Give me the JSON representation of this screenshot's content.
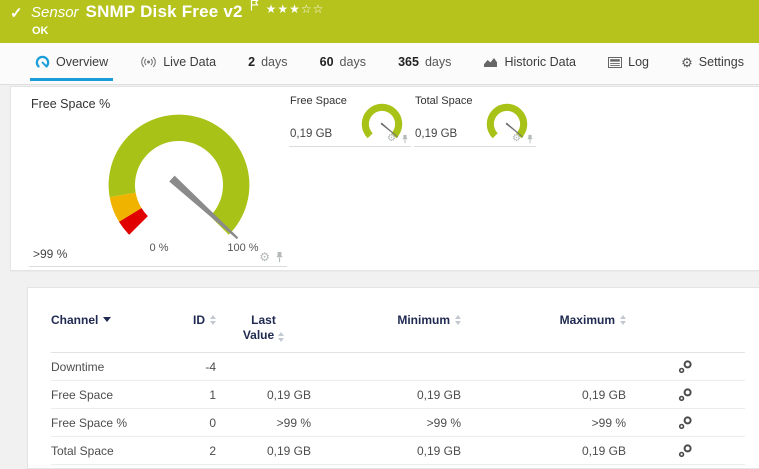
{
  "header": {
    "kind": "Sensor",
    "name": "SNMP Disk Free v2",
    "status": "OK",
    "stars_filled": "★★★",
    "stars_empty": "☆☆",
    "color": "#b5c31c"
  },
  "tabs": [
    {
      "icon": "gauge-icon",
      "label": "Overview",
      "active": true
    },
    {
      "icon": "live-icon",
      "label": "Live Data"
    },
    {
      "num": "2",
      "unit": "days"
    },
    {
      "num": "60",
      "unit": "days"
    },
    {
      "num": "365",
      "unit": "days"
    },
    {
      "icon": "historic-icon",
      "label": "Historic Data"
    },
    {
      "icon": "log-icon",
      "label": "Log"
    },
    {
      "icon": "settings-icon",
      "label": "Settings"
    }
  ],
  "gauges": {
    "main": {
      "title": "Free Space %",
      "value": ">99 %",
      "min_label": "0 %",
      "max_label": "100 %",
      "percent": 99,
      "unit": "%",
      "segments": [
        {
          "to": 5,
          "color": "#e00000"
        },
        {
          "to": 13,
          "color": "#f0b400"
        },
        {
          "to": 100,
          "color": "#a9c217"
        }
      ]
    },
    "minis": [
      {
        "title": "Free Space",
        "value": "0,19 GB",
        "percent": 98,
        "color": "#a9c217"
      },
      {
        "title": "Total Space",
        "value": "0,19 GB",
        "percent": 98,
        "color": "#a9c217"
      }
    ]
  },
  "table": {
    "columns": {
      "channel": "Channel",
      "id": "ID",
      "last_line1": "Last",
      "last_line2": "Value",
      "min": "Minimum",
      "max": "Maximum"
    },
    "rows": [
      {
        "channel": "Downtime",
        "id": "-4",
        "last": "",
        "min": "",
        "max": ""
      },
      {
        "channel": "Free Space",
        "id": "1",
        "last": "0,19 GB",
        "min": "0,19 GB",
        "max": "0,19 GB"
      },
      {
        "channel": "Free Space %",
        "id": "0",
        "last": ">99 %",
        "min": ">99 %",
        "max": ">99 %"
      },
      {
        "channel": "Total Space",
        "id": "2",
        "last": "0,19 GB",
        "min": "0,19 GB",
        "max": "0,19 GB"
      }
    ]
  },
  "icons": {
    "gear": "⚙"
  }
}
